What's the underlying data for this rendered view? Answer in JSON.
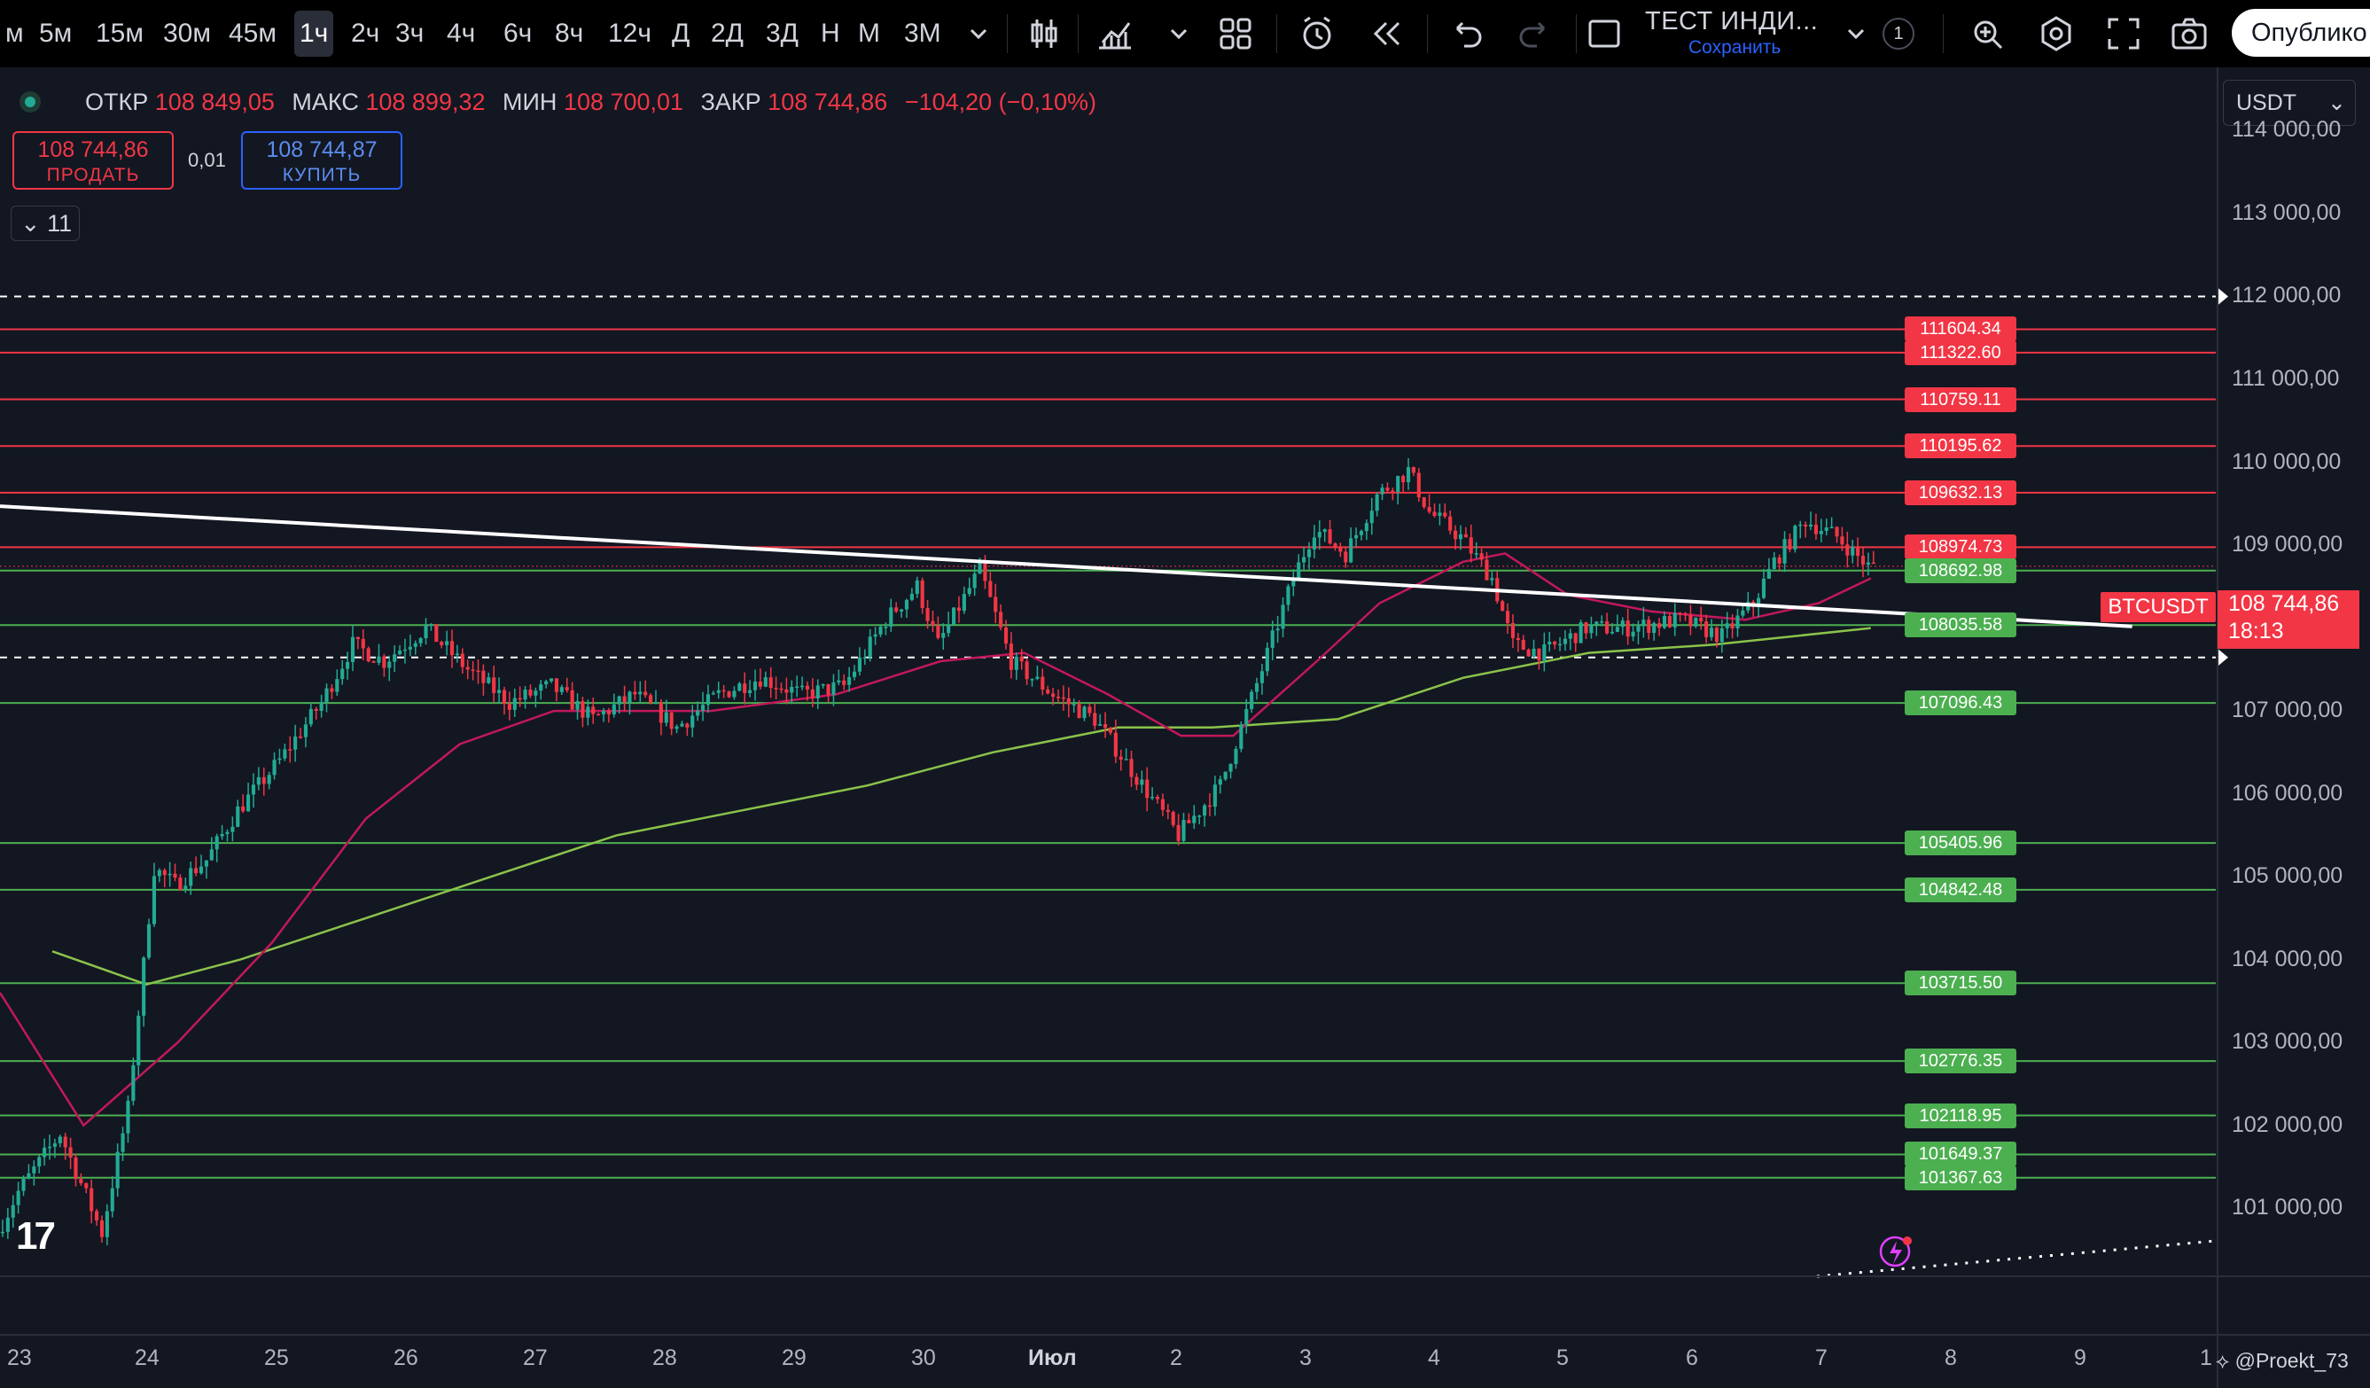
{
  "toolbar": {
    "timeframes": [
      "м",
      "5м",
      "15м",
      "30м",
      "45м",
      "1ч",
      "2ч",
      "3ч",
      "4ч",
      "6ч",
      "8ч",
      "12ч",
      "Д",
      "2Д",
      "3Д",
      "Н",
      "М",
      "3М"
    ],
    "active_timeframe": "1ч",
    "layout_name": "ТЕСТ ИНДИ...",
    "layout_save": "Сохранить",
    "alerts_count": "1",
    "publish_label": "Опублико"
  },
  "legend": {
    "open_label": "ОТКР",
    "open": "108 849,05",
    "high_label": "МАКС",
    "high": "108 899,32",
    "low_label": "МИН",
    "low": "108 700,01",
    "close_label": "ЗАКР",
    "close": "108 744,86",
    "change": "−104,20 (−0,10%)"
  },
  "trade": {
    "sell_price": "108 744,86",
    "sell_label": "ПРОДАТЬ",
    "spread": "0,01",
    "buy_price": "108 744,87",
    "buy_label": "КУПИТЬ",
    "collapse_count": "11"
  },
  "currency": "USDT",
  "symbol_badge": "BTCUSDT",
  "last_price": "108 744,86",
  "countdown": "18:13",
  "watermark": "@Proekt_73",
  "colors": {
    "up": "#22ab94",
    "down": "#f23645",
    "background": "#131722",
    "resistance": "#f23645",
    "support": "#4caf50",
    "ma_fast": "#c2185b",
    "ma_slow": "#8bc34a"
  },
  "chart_data": {
    "type": "candlestick",
    "symbol": "BTCUSDT",
    "interval": "1ч",
    "ylim": [
      100200,
      114700
    ],
    "y_ticks": [
      {
        "value": 101000,
        "label": "101 000,00"
      },
      {
        "value": 102000,
        "label": "102 000,00"
      },
      {
        "value": 103000,
        "label": "103 000,00"
      },
      {
        "value": 104000,
        "label": "104 000,00"
      },
      {
        "value": 105000,
        "label": "105 000,00"
      },
      {
        "value": 106000,
        "label": "106 000,00"
      },
      {
        "value": 107000,
        "label": "107 000,00"
      },
      {
        "value": 108000,
        "label": "108 000,00"
      },
      {
        "value": 109000,
        "label": "109 000,00"
      },
      {
        "value": 110000,
        "label": "110 000,00"
      },
      {
        "value": 111000,
        "label": "111 000,00"
      },
      {
        "value": 112000,
        "label": "112 000,00"
      },
      {
        "value": 113000,
        "label": "113 000,00"
      },
      {
        "value": 114000,
        "label": "114 000,00"
      }
    ],
    "x_ticks": [
      "23",
      "24",
      "25",
      "26",
      "27",
      "28",
      "29",
      "30",
      "Июл",
      "2",
      "3",
      "4",
      "5",
      "6",
      "7",
      "8",
      "9",
      "1"
    ],
    "x_range": [
      "2025-06-22T20:00",
      "2025-07-10T12:00"
    ],
    "resistance_levels": [
      111604.34,
      111322.6,
      110759.11,
      110195.62,
      109632.13,
      108974.73
    ],
    "support_levels": [
      108692.98,
      108035.58,
      107096.43,
      105405.96,
      104842.48,
      103715.5,
      102776.35,
      102118.95,
      101649.37,
      101367.63
    ],
    "dashed_levels": [
      112000,
      107645
    ],
    "trendline": {
      "start": [
        "2025-06-22T20:00",
        109470
      ],
      "end": [
        "2025-07-09T20:00",
        108020
      ]
    },
    "price_path": [
      [
        "2025-06-22T20:00",
        100700
      ],
      [
        "2025-06-23T00:00",
        101200
      ],
      [
        "2025-06-23T08:00",
        101900
      ],
      [
        "2025-06-23T16:00",
        100700
      ],
      [
        "2025-06-23T21:00",
        102200
      ],
      [
        "2025-06-24T02:00",
        105100
      ],
      [
        "2025-06-24T06:00",
        104900
      ],
      [
        "2025-06-24T12:00",
        105200
      ],
      [
        "2025-06-24T18:00",
        105800
      ],
      [
        "2025-06-25T02:00",
        106400
      ],
      [
        "2025-06-25T10:00",
        107100
      ],
      [
        "2025-06-25T16:00",
        107800
      ],
      [
        "2025-06-25T22:00",
        107600
      ],
      [
        "2025-06-26T06:00",
        108000
      ],
      [
        "2025-06-26T14:00",
        107500
      ],
      [
        "2025-06-26T22:00",
        107100
      ],
      [
        "2025-06-27T06:00",
        107300
      ],
      [
        "2025-06-27T14:00",
        106900
      ],
      [
        "2025-06-27T22:00",
        107200
      ],
      [
        "2025-06-28T06:00",
        106800
      ],
      [
        "2025-06-28T14:00",
        107200
      ],
      [
        "2025-06-28T22:00",
        107400
      ],
      [
        "2025-06-29T06:00",
        107200
      ],
      [
        "2025-06-29T14:00",
        107300
      ],
      [
        "2025-06-29T22:00",
        108100
      ],
      [
        "2025-06-30T04:00",
        108500
      ],
      [
        "2025-06-30T08:00",
        107800
      ],
      [
        "2025-06-30T16:00",
        108700
      ],
      [
        "2025-06-30T22:00",
        107600
      ],
      [
        "2025-07-01T06:00",
        107200
      ],
      [
        "2025-07-01T14:00",
        106900
      ],
      [
        "2025-07-01T22:00",
        106200
      ],
      [
        "2025-07-02T06:00",
        105500
      ],
      [
        "2025-07-02T14:00",
        106100
      ],
      [
        "2025-07-02T22:00",
        107500
      ],
      [
        "2025-07-03T04:00",
        108600
      ],
      [
        "2025-07-03T08:00",
        109200
      ],
      [
        "2025-07-03T14:00",
        108900
      ],
      [
        "2025-07-03T20:00",
        109600
      ],
      [
        "2025-07-04T02:00",
        109900
      ],
      [
        "2025-07-04T06:00",
        109400
      ],
      [
        "2025-07-04T12:00",
        109100
      ],
      [
        "2025-07-04T18:00",
        108600
      ],
      [
        "2025-07-04T22:00",
        107800
      ],
      [
        "2025-07-05T04:00",
        107700
      ],
      [
        "2025-07-05T12:00",
        108000
      ],
      [
        "2025-07-05T20:00",
        108000
      ],
      [
        "2025-07-06T06:00",
        108100
      ],
      [
        "2025-07-06T14:00",
        107900
      ],
      [
        "2025-07-06T20:00",
        108300
      ],
      [
        "2025-07-07T00:00",
        108800
      ],
      [
        "2025-07-07T06:00",
        109300
      ],
      [
        "2025-07-07T12:00",
        109100
      ],
      [
        "2025-07-07T18:00",
        108745
      ]
    ],
    "ma_fast": [
      [
        "2025-06-22T20:00",
        103600
      ],
      [
        "2025-06-23T12:00",
        102000
      ],
      [
        "2025-06-24T06:00",
        103000
      ],
      [
        "2025-06-25T00:00",
        104200
      ],
      [
        "2025-06-25T18:00",
        105700
      ],
      [
        "2025-06-26T12:00",
        106600
      ],
      [
        "2025-06-27T06:00",
        107000
      ],
      [
        "2025-06-28T12:00",
        107000
      ],
      [
        "2025-06-29T12:00",
        107200
      ],
      [
        "2025-06-30T08:00",
        107600
      ],
      [
        "2025-07-01T00:00",
        107700
      ],
      [
        "2025-07-01T16:00",
        107200
      ],
      [
        "2025-07-02T06:00",
        106700
      ],
      [
        "2025-07-02T16:00",
        106700
      ],
      [
        "2025-07-03T08:00",
        107600
      ],
      [
        "2025-07-03T20:00",
        108300
      ],
      [
        "2025-07-04T12:00",
        108800
      ],
      [
        "2025-07-04T20:00",
        108900
      ],
      [
        "2025-07-05T08:00",
        108400
      ],
      [
        "2025-07-06T00:00",
        108200
      ],
      [
        "2025-07-06T18:00",
        108100
      ],
      [
        "2025-07-07T08:00",
        108300
      ],
      [
        "2025-07-07T18:00",
        108600
      ]
    ],
    "ma_slow": [
      [
        "2025-06-23T06:00",
        104100
      ],
      [
        "2025-06-24T00:00",
        103700
      ],
      [
        "2025-06-24T18:00",
        104000
      ],
      [
        "2025-06-25T18:00",
        104500
      ],
      [
        "2025-06-26T18:00",
        105000
      ],
      [
        "2025-06-27T18:00",
        105500
      ],
      [
        "2025-06-28T18:00",
        105800
      ],
      [
        "2025-06-29T18:00",
        106100
      ],
      [
        "2025-06-30T18:00",
        106500
      ],
      [
        "2025-07-01T18:00",
        106800
      ],
      [
        "2025-07-02T12:00",
        106800
      ],
      [
        "2025-07-03T12:00",
        106900
      ],
      [
        "2025-07-04T12:00",
        107400
      ],
      [
        "2025-07-05T12:00",
        107700
      ],
      [
        "2025-07-06T12:00",
        107800
      ],
      [
        "2025-07-07T18:00",
        108000
      ]
    ]
  }
}
